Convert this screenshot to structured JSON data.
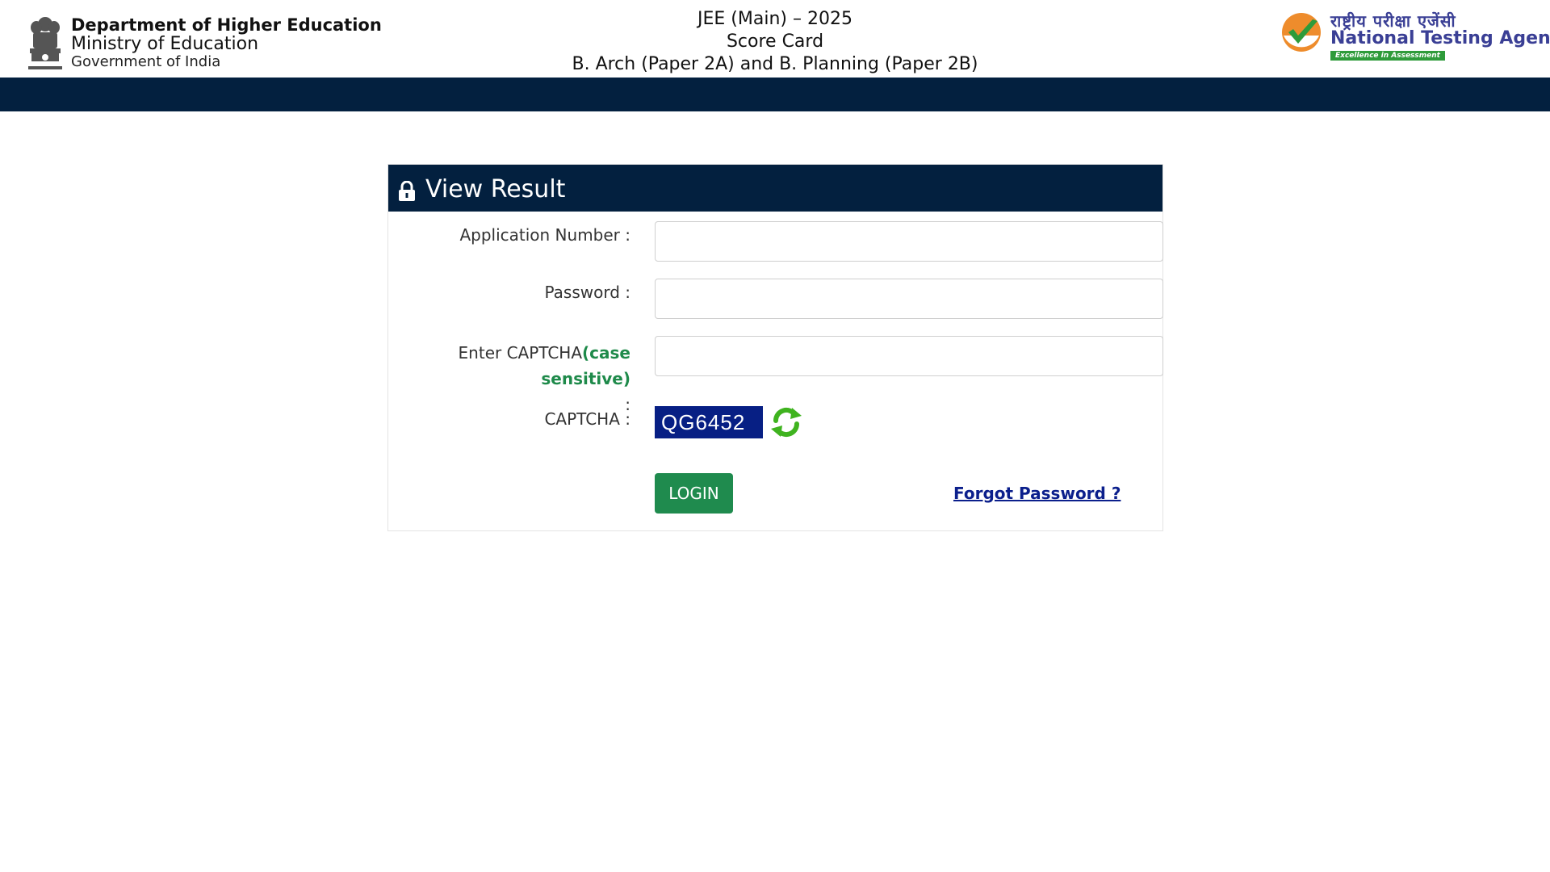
{
  "header": {
    "department": "Department of Higher Education",
    "ministry": "Ministry of Education",
    "government": "Government of India",
    "emblem_icon": "national-emblem-icon",
    "exam_title": "JEE (Main) – 2025",
    "doc_title": "Score Card",
    "paper_title": "B. Arch (Paper 2A) and B. Planning (Paper 2B)",
    "agency_hindi": "राष्ट्रीय परीक्षा एजेंसी",
    "agency_name": "National Testing Agency",
    "agency_tagline": "Excellence in Assessment",
    "agency_logo_icon": "nta-checkmark-logo-icon"
  },
  "colors": {
    "navbar": "#03203f",
    "card_header": "#03203f",
    "login_button": "#1f8b4e",
    "captcha_bg": "#071f84",
    "case_sensitive": "#1e8a4a",
    "link": "#0b1f8c"
  },
  "login": {
    "title": "View Result",
    "title_icon": "lock-icon",
    "application_label": "Application Number :",
    "application_value": "",
    "password_label": "Password :",
    "password_value": "",
    "captcha_input_label": "Enter CAPTCHA",
    "captcha_case_note": "(case sensitive)",
    "captcha_input_suffix": ":",
    "captcha_input_value": "",
    "captcha_label": "CAPTCHA :",
    "captcha_code": "QG6452",
    "refresh_icon": "refresh-icon",
    "login_button": "LOGIN",
    "forgot_link": "Forgot Password ?"
  }
}
